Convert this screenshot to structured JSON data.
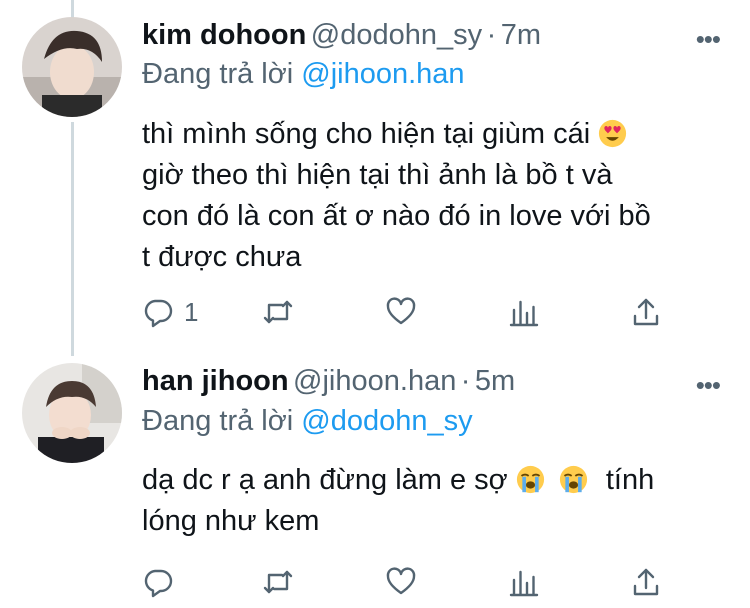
{
  "tweets": [
    {
      "display_name": "kim dohoon",
      "handle": "@dodohn_sy",
      "separator": "·",
      "time": "7m",
      "replying_prefix": "Đang trả lời",
      "replying_to": "@jihoon.han",
      "text_lines": [
        "thì mình sống cho hiện tại giùm cái",
        "giờ theo thì hiện tại thì ảnh là bồ t và",
        "con đó là con ất ơ nào đó in love với bồ",
        "t được chưa"
      ],
      "line1_emoji": "heart-eyes-emoji",
      "reply_count": "1",
      "more": "•••"
    },
    {
      "display_name": "han jihoon",
      "handle": "@jihoon.han",
      "separator": "·",
      "time": "5m",
      "replying_prefix": "Đang trả lời",
      "replying_to": "@dodohn_sy",
      "text_line1_a": "dạ dc r ạ anh đừng làm e sợ",
      "text_line1_b": "tính",
      "text_line2": "lóng như kem",
      "line1_emojis": [
        "loudly-crying-emoji",
        "loudly-crying-emoji"
      ],
      "more": "•••"
    }
  ],
  "icons": [
    "reply-icon",
    "retweet-icon",
    "like-icon",
    "analytics-icon",
    "share-icon"
  ],
  "colors": {
    "accent": "#1d9bf0",
    "muted": "#536471",
    "text": "#0f1419",
    "thread": "#cfd9de"
  }
}
